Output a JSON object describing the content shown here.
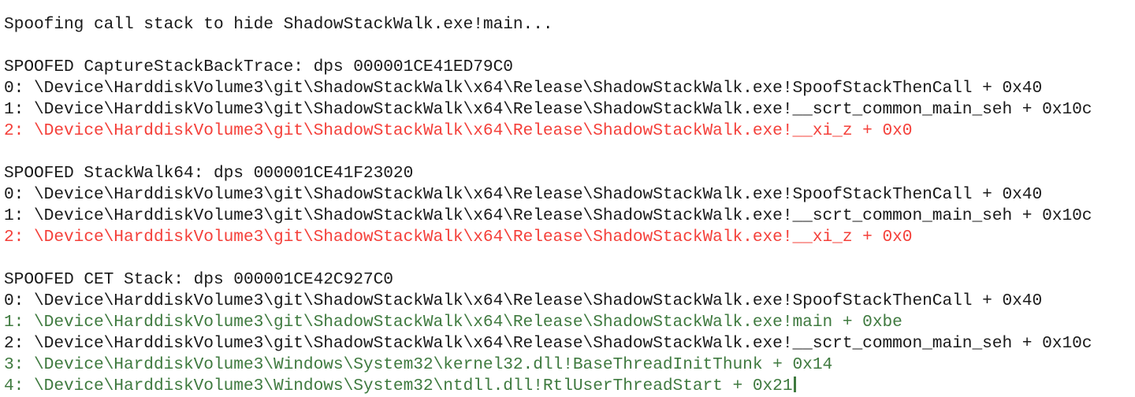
{
  "terminal": {
    "background_color": "#ffffff",
    "default_text_color": "#1a1a1a",
    "red_color": "#f4403a",
    "green_color": "#3f7a3f",
    "cursor_color": "#3f7a3f",
    "lines": [
      {
        "id": "intro",
        "color": "default",
        "text": "Spoofing call stack to hide ShadowStackWalk.exe!main..."
      },
      {
        "id": "blank-1",
        "color": "default",
        "text": ""
      },
      {
        "id": "block1-header",
        "color": "default",
        "text": "SPOOFED CaptureStackBackTrace: dps 000001CE41ED79C0"
      },
      {
        "id": "block1-frame-0",
        "color": "default",
        "text": "0: \\Device\\HarddiskVolume3\\git\\ShadowStackWalk\\x64\\Release\\ShadowStackWalk.exe!SpoofStackThenCall + 0x40"
      },
      {
        "id": "block1-frame-1",
        "color": "default",
        "text": "1: \\Device\\HarddiskVolume3\\git\\ShadowStackWalk\\x64\\Release\\ShadowStackWalk.exe!__scrt_common_main_seh + 0x10c"
      },
      {
        "id": "block1-frame-2",
        "color": "red",
        "text": "2: \\Device\\HarddiskVolume3\\git\\ShadowStackWalk\\x64\\Release\\ShadowStackWalk.exe!__xi_z + 0x0"
      },
      {
        "id": "blank-2",
        "color": "default",
        "text": ""
      },
      {
        "id": "block2-header",
        "color": "default",
        "text": "SPOOFED StackWalk64: dps 000001CE41F23020"
      },
      {
        "id": "block2-frame-0",
        "color": "default",
        "text": "0: \\Device\\HarddiskVolume3\\git\\ShadowStackWalk\\x64\\Release\\ShadowStackWalk.exe!SpoofStackThenCall + 0x40"
      },
      {
        "id": "block2-frame-1",
        "color": "default",
        "text": "1: \\Device\\HarddiskVolume3\\git\\ShadowStackWalk\\x64\\Release\\ShadowStackWalk.exe!__scrt_common_main_seh + 0x10c"
      },
      {
        "id": "block2-frame-2",
        "color": "red",
        "text": "2: \\Device\\HarddiskVolume3\\git\\ShadowStackWalk\\x64\\Release\\ShadowStackWalk.exe!__xi_z + 0x0"
      },
      {
        "id": "blank-3",
        "color": "default",
        "text": ""
      },
      {
        "id": "block3-header",
        "color": "default",
        "text": "SPOOFED CET Stack: dps 000001CE42C927C0"
      },
      {
        "id": "block3-frame-0",
        "color": "default",
        "text": "0: \\Device\\HarddiskVolume3\\git\\ShadowStackWalk\\x64\\Release\\ShadowStackWalk.exe!SpoofStackThenCall + 0x40"
      },
      {
        "id": "block3-frame-1",
        "color": "green",
        "text": "1: \\Device\\HarddiskVolume3\\git\\ShadowStackWalk\\x64\\Release\\ShadowStackWalk.exe!main + 0xbe"
      },
      {
        "id": "block3-frame-2",
        "color": "default",
        "text": "2: \\Device\\HarddiskVolume3\\git\\ShadowStackWalk\\x64\\Release\\ShadowStackWalk.exe!__scrt_common_main_seh + 0x10c"
      },
      {
        "id": "block3-frame-3",
        "color": "green",
        "text": "3: \\Device\\HarddiskVolume3\\Windows\\System32\\kernel32.dll!BaseThreadInitThunk + 0x14"
      },
      {
        "id": "block3-frame-4",
        "color": "green",
        "text": "4: \\Device\\HarddiskVolume3\\Windows\\System32\\ntdll.dll!RtlUserThreadStart + 0x21",
        "cursor": true
      }
    ]
  }
}
